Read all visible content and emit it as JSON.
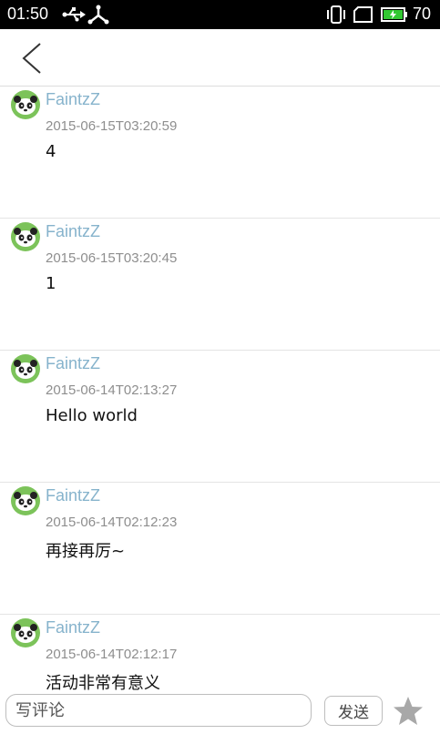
{
  "status_bar": {
    "time": "01:50",
    "battery": "70",
    "icons": [
      "usb-icon",
      "usb-debug-icon",
      "vibrate-icon",
      "sim-icon",
      "battery-charging-icon"
    ]
  },
  "header": {
    "back_icon": "chevron-left-icon"
  },
  "comments": [
    {
      "user": "FaintzZ",
      "time": "2015-06-15T03:20:59",
      "text": "4"
    },
    {
      "user": "FaintzZ",
      "time": "2015-06-15T03:20:45",
      "text": "1"
    },
    {
      "user": "FaintzZ",
      "time": "2015-06-14T02:13:27",
      "text": "Hello world"
    },
    {
      "user": "FaintzZ",
      "time": "2015-06-14T02:12:23",
      "text": "再接再厉~"
    },
    {
      "user": "FaintzZ",
      "time": "2015-06-14T02:12:17",
      "text": "活动非常有意义"
    }
  ],
  "composer": {
    "placeholder": "写评论",
    "send_label": "发送",
    "star_icon": "star-icon"
  },
  "colors": {
    "username": "#86b3cc",
    "avatar_bg": "#7cc35a",
    "status_bar_bg": "#000000"
  }
}
